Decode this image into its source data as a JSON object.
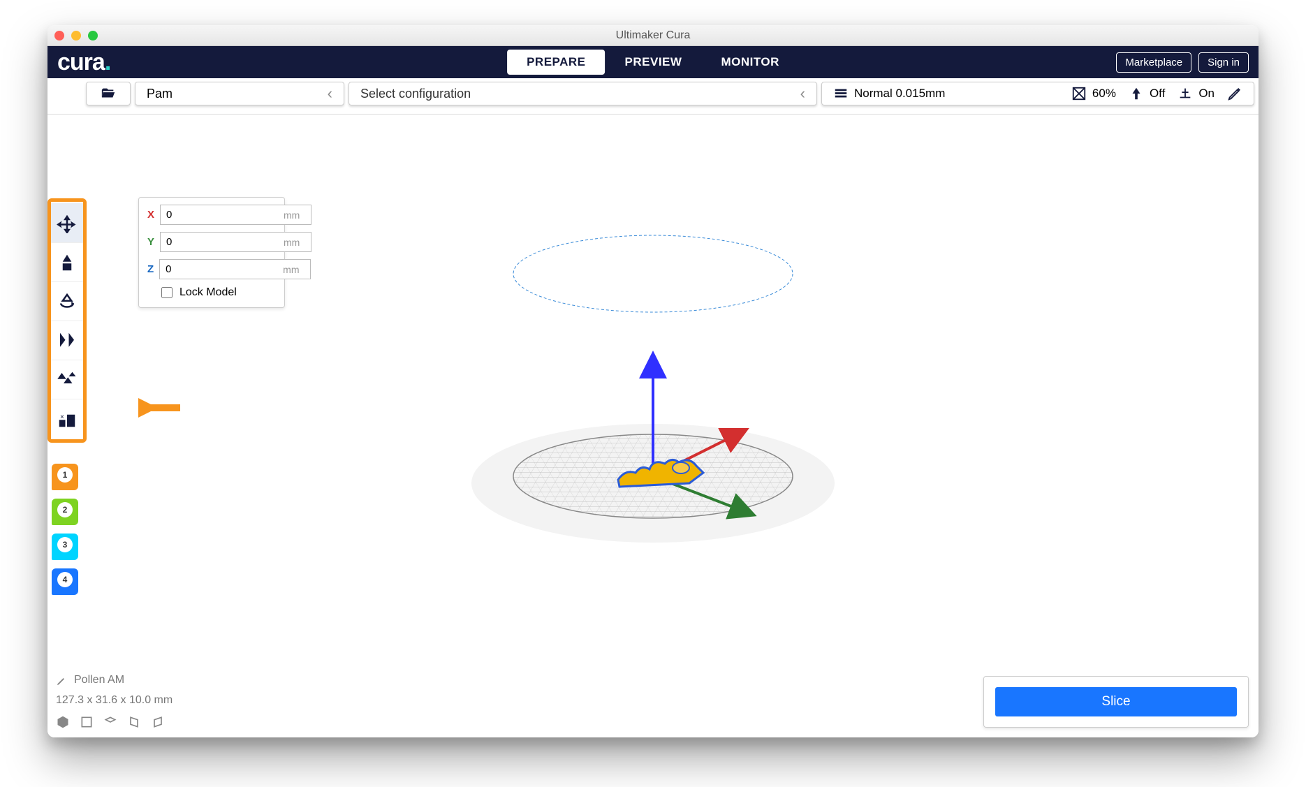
{
  "window": {
    "title": "Ultimaker Cura"
  },
  "logo": {
    "text": "cura",
    "accent": "."
  },
  "tabs": {
    "prepare": "PREPARE",
    "preview": "PREVIEW",
    "monitor": "MONITOR",
    "active": "prepare"
  },
  "topbar_buttons": {
    "marketplace": "Marketplace",
    "signin": "Sign in"
  },
  "configbar": {
    "printer": "Pam",
    "configuration": "Select configuration",
    "profile": "Normal 0.015mm",
    "infill": "60%",
    "support": "Off",
    "adhesion": "On"
  },
  "move_panel": {
    "x_label": "X",
    "x_value": "0",
    "y_label": "Y",
    "y_value": "0",
    "z_label": "Z",
    "z_value": "0",
    "unit": "mm",
    "lock_label": "Lock Model",
    "lock_checked": false
  },
  "extruders": [
    "1",
    "2",
    "3",
    "4"
  ],
  "footer": {
    "model_name": "Pollen AM",
    "dimensions": "127.3 x 31.6 x 10.0 mm"
  },
  "slice": {
    "label": "Slice"
  }
}
